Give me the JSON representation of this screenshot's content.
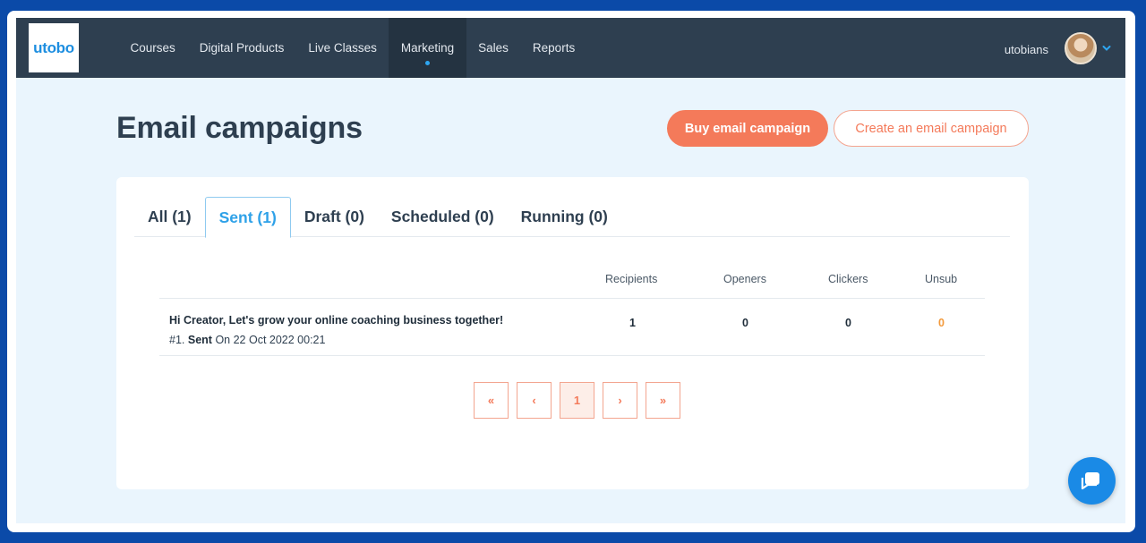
{
  "brand": {
    "logo_text": "utobo"
  },
  "nav": {
    "items": [
      {
        "label": "Courses"
      },
      {
        "label": "Digital Products"
      },
      {
        "label": "Live Classes"
      },
      {
        "label": "Marketing"
      },
      {
        "label": "Sales"
      },
      {
        "label": "Reports"
      }
    ],
    "active": "Marketing"
  },
  "user": {
    "name": "utobians"
  },
  "page": {
    "title": "Email campaigns",
    "buy_button": "Buy email campaign",
    "create_button": "Create an email campaign"
  },
  "tabs": [
    {
      "label": "All (1)"
    },
    {
      "label": "Sent (1)"
    },
    {
      "label": "Draft (0)"
    },
    {
      "label": "Scheduled (0)"
    },
    {
      "label": "Running (0)"
    }
  ],
  "table": {
    "headers": [
      "Recipients",
      "Openers",
      "Clickers",
      "Unsub"
    ],
    "rows": [
      {
        "subject": "Hi Creator, Let's grow your online coaching business together!",
        "number": "#1.",
        "status": "Sent",
        "sent_on": "On 22 Oct 2022 00:21",
        "recipients": "1",
        "openers": "0",
        "clickers": "0",
        "unsub": "0"
      }
    ]
  },
  "pagination": {
    "first": "«",
    "prev": "‹",
    "current": "1",
    "next": "›",
    "last": "»"
  },
  "colors": {
    "accent": "#f47a5a",
    "nav_bg": "#2e3f50",
    "active_tab": "#2ea1e8",
    "page_bg": "#eaf5fd",
    "chat": "#1a8ae6",
    "unsub_value": "#f39a3c"
  },
  "icons": {
    "user_menu": "chevron-down-icon",
    "chat": "chat-bubble-icon"
  }
}
